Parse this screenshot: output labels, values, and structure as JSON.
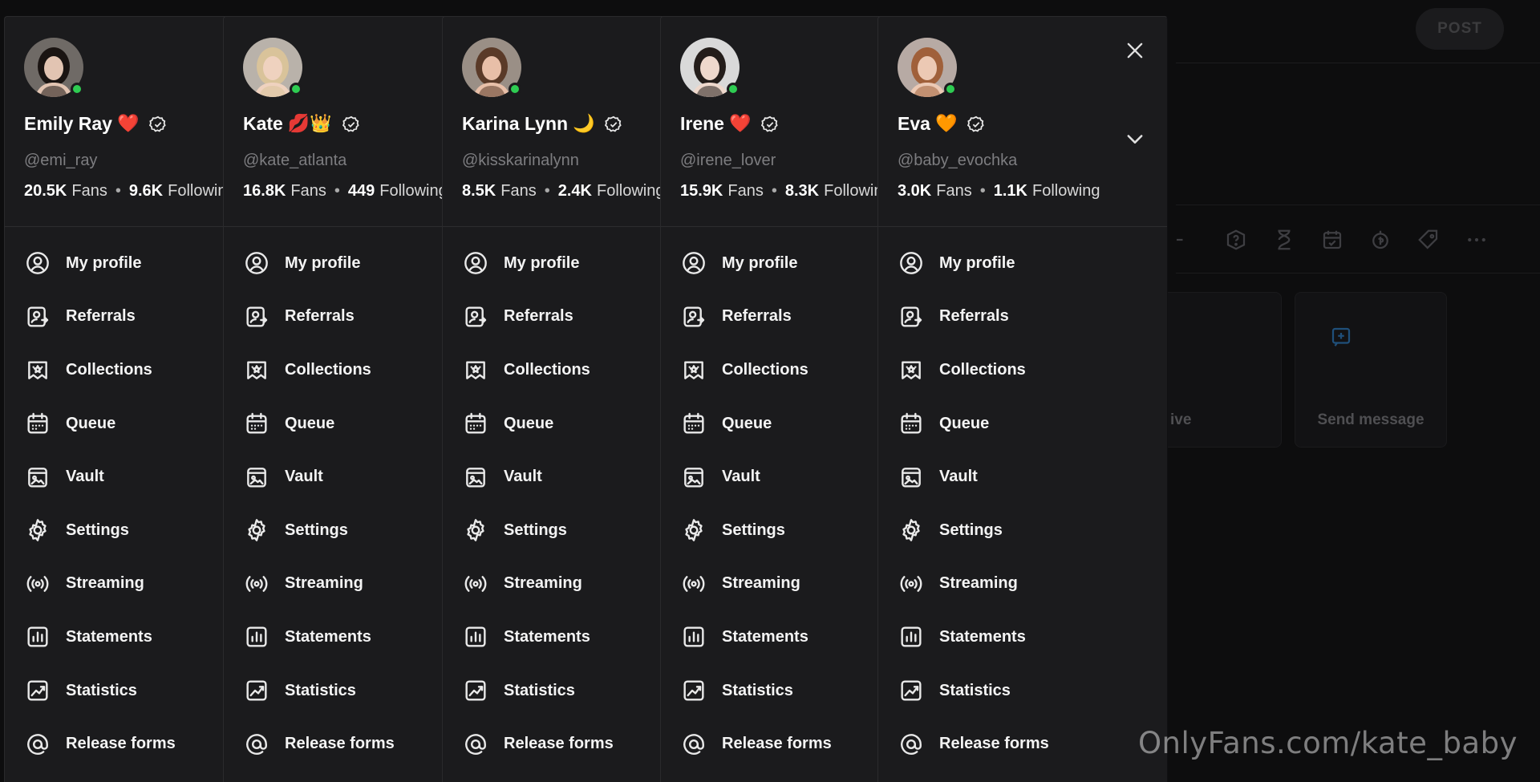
{
  "background": {
    "post_button": "POST",
    "toolbar_icons": [
      "question-icon",
      "hourglass-icon",
      "calendar-check-icon",
      "coin-icon",
      "tag-icon",
      "more-icon"
    ],
    "cards": [
      {
        "label": "ive"
      },
      {
        "label": "Send message"
      }
    ]
  },
  "profiles": [
    {
      "name": "Emily Ray",
      "emojis": [
        "❤️"
      ],
      "handle": "@emi_ray",
      "fans": "20.5K",
      "fans_label": "Fans",
      "following": "9.6K",
      "following_label": "Following"
    },
    {
      "name": "Kate",
      "emojis": [
        "💋",
        "👑"
      ],
      "handle": "@kate_atlanta",
      "fans": "16.8K",
      "fans_label": "Fans",
      "following": "449",
      "following_label": "Following"
    },
    {
      "name": "Karina Lynn",
      "emojis": [
        "🌙"
      ],
      "handle": "@kisskarinalynn",
      "fans": "8.5K",
      "fans_label": "Fans",
      "following": "2.4K",
      "following_label": "Following"
    },
    {
      "name": "Irene",
      "emojis": [
        "❤️"
      ],
      "handle": "@irene_lover",
      "fans": "15.9K",
      "fans_label": "Fans",
      "following": "8.3K",
      "following_label": "Following"
    },
    {
      "name": "Eva",
      "emojis": [
        "🧡"
      ],
      "handle": "@baby_evochka",
      "fans": "3.0K",
      "fans_label": "Fans",
      "following": "1.1K",
      "following_label": "Following"
    }
  ],
  "menu": [
    {
      "label": "My profile",
      "icon": "user-circle-icon"
    },
    {
      "label": "Referrals",
      "icon": "referrals-icon"
    },
    {
      "label": "Collections",
      "icon": "collections-icon"
    },
    {
      "label": "Queue",
      "icon": "calendar-icon"
    },
    {
      "label": "Vault",
      "icon": "vault-icon"
    },
    {
      "label": "Settings",
      "icon": "gear-icon"
    },
    {
      "label": "Streaming",
      "icon": "streaming-icon"
    },
    {
      "label": "Statements",
      "icon": "statements-icon"
    },
    {
      "label": "Statistics",
      "icon": "statistics-icon"
    },
    {
      "label": "Release forms",
      "icon": "at-sign-icon"
    }
  ],
  "watermark": "OnlyFans.com/kate_baby",
  "colors": {
    "panel_bg": "#1b1b1d",
    "page_bg": "#0d0d0e",
    "online": "#2ecc52",
    "text": "#f4f4f4",
    "muted": "#7d7d80"
  }
}
